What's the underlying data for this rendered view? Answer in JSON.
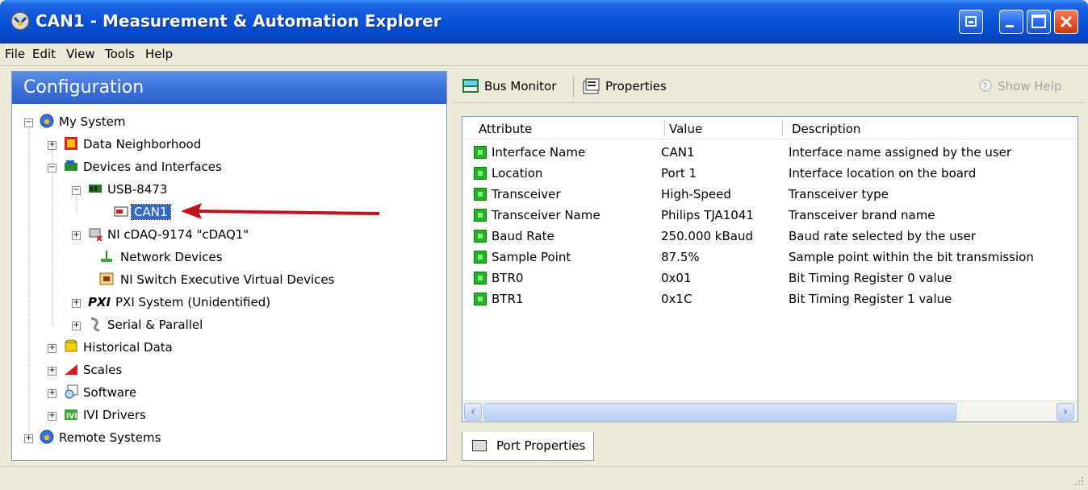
{
  "window": {
    "title": "CAN1 - Measurement & Automation Explorer"
  },
  "menu": [
    "File",
    "Edit",
    "View",
    "Tools",
    "Help"
  ],
  "config_header": "Configuration",
  "tree": [
    {
      "label": "My System",
      "icon": "my-system-icon"
    },
    {
      "label": "Data Neighborhood",
      "icon": "data-neighborhood-icon"
    },
    {
      "label": "Devices and Interfaces",
      "icon": "devices-icon"
    },
    {
      "label": "USB-8473",
      "icon": "usb-device-icon"
    },
    {
      "label": "CAN1",
      "icon": "can-port-icon"
    },
    {
      "label": "NI cDAQ-9174 \"cDAQ1\"",
      "icon": "cdaq-icon"
    },
    {
      "label": "Network Devices",
      "icon": "network-devices-icon"
    },
    {
      "label": "NI Switch Executive Virtual Devices",
      "icon": "switch-executive-icon"
    },
    {
      "label": "PXI System (Unidentified)",
      "icon": "pxi-icon"
    },
    {
      "label": "Serial & Parallel",
      "icon": "serial-parallel-icon"
    },
    {
      "label": "Historical Data",
      "icon": "historical-data-icon"
    },
    {
      "label": "Scales",
      "icon": "scales-icon"
    },
    {
      "label": "Software",
      "icon": "software-icon"
    },
    {
      "label": "IVI Drivers",
      "icon": "ivi-drivers-icon"
    },
    {
      "label": "Remote Systems",
      "icon": "remote-systems-icon"
    }
  ],
  "toolbar": {
    "bus_monitor": "Bus Monitor",
    "properties": "Properties",
    "show_help": "Show Help"
  },
  "grid": {
    "headers": [
      "Attribute",
      "Value",
      "Description"
    ],
    "rows": [
      {
        "attribute": "Interface Name",
        "value": "CAN1",
        "description": "Interface name assigned by the user"
      },
      {
        "attribute": "Location",
        "value": "Port 1",
        "description": "Interface location on the board"
      },
      {
        "attribute": "Transceiver",
        "value": "High-Speed",
        "description": "Transceiver type"
      },
      {
        "attribute": "Transceiver Name",
        "value": "Philips TJA1041",
        "description": "Transceiver brand name"
      },
      {
        "attribute": "Baud Rate",
        "value": "250.000 kBaud",
        "description": "Baud rate selected by the user"
      },
      {
        "attribute": "Sample Point",
        "value": "87.5%",
        "description": "Sample point within the bit transmission"
      },
      {
        "attribute": "BTR0",
        "value": "0x01",
        "description": "Bit Timing Register 0 value"
      },
      {
        "attribute": "BTR1",
        "value": "0x1C",
        "description": "Bit Timing Register 1 value"
      }
    ]
  },
  "tab": {
    "label": "Port Properties"
  },
  "colors": {
    "title_blue": "#0a54d8",
    "selection": "#316ac5",
    "arrow": "#c0141c",
    "row_icon_green": "#23b323"
  }
}
